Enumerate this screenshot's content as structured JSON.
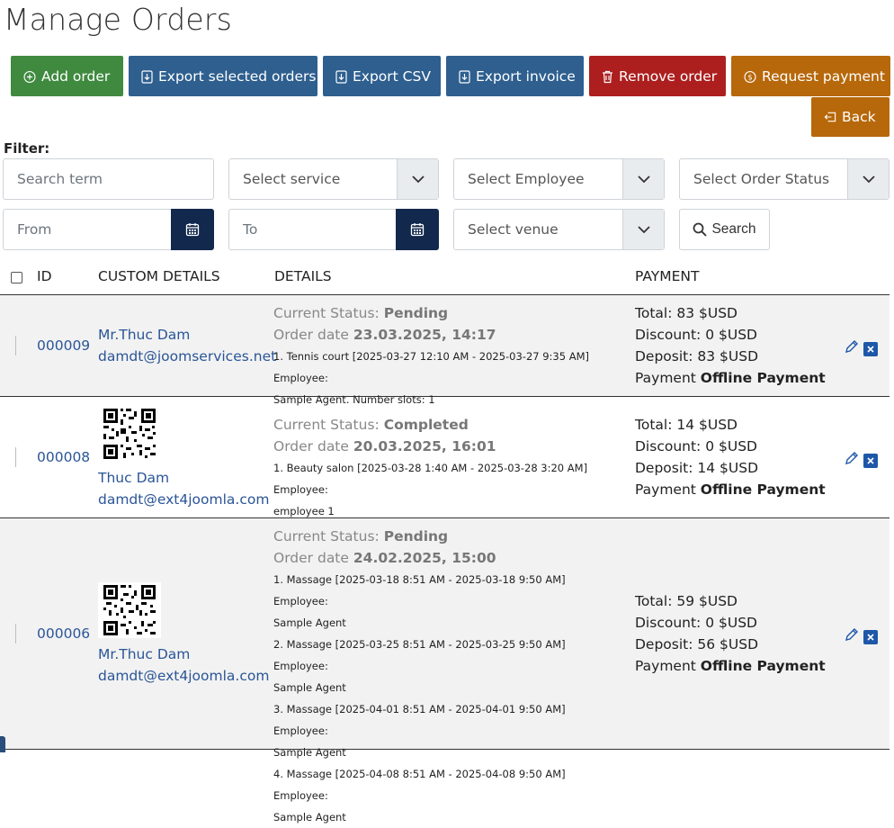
{
  "page": {
    "title": "Manage Orders"
  },
  "toolbar": {
    "add_order": "Add order",
    "export_selected": "Export selected orders",
    "export_csv": "Export CSV",
    "export_invoice": "Export invoice",
    "remove_order": "Remove order",
    "request_payment": "Request payment",
    "back": "Back"
  },
  "filter": {
    "label": "Filter:",
    "search_placeholder": "Search term",
    "service": "Select service",
    "employee": "Select Employee",
    "order_status": "Select Order Status",
    "from": "From",
    "to": "To",
    "venue": "Select venue",
    "search_button": "Search"
  },
  "table": {
    "columns": {
      "id": "ID",
      "custom": "CUSTOM DETAILS",
      "details": "DETAILS",
      "payment": "PAYMENT"
    },
    "rows": [
      {
        "id": "000009",
        "name": "Mr.Thuc Dam",
        "email": "damdt@joomservices.net",
        "status_label": "Current Status:",
        "status": "Pending",
        "date_label": "Order date",
        "date": "23.03.2025, 14:17",
        "items": [
          "1. Tennis court [2025-03-27 12:10 AM - 2025-03-27 9:35 AM] Employee:",
          "Sample Agent. Number slots: 1"
        ],
        "total": "Total: 83 $USD",
        "discount": "Discount: 0 $USD",
        "deposit": "Deposit: 83 $USD",
        "payment_label": "Payment",
        "payment_method": "Offline Payment"
      },
      {
        "id": "000008",
        "name": "Thuc Dam",
        "email": "damdt@ext4joomla.com",
        "status_label": "Current Status:",
        "status": "Completed",
        "date_label": "Order date",
        "date": "20.03.2025, 16:01",
        "items": [
          "1. Beauty salon [2025-03-28 1:40 AM - 2025-03-28 3:20 AM] Employee:",
          "employee 1"
        ],
        "total": "Total: 14 $USD",
        "discount": "Discount: 0 $USD",
        "deposit": "Deposit: 14 $USD",
        "payment_label": "Payment",
        "payment_method": "Offline Payment"
      },
      {
        "id": "000006",
        "name": "Mr.Thuc Dam",
        "email": "damdt@ext4joomla.com",
        "status_label": "Current Status:",
        "status": "Pending",
        "date_label": "Order date",
        "date": "24.02.2025, 15:00",
        "items": [
          "1. Massage [2025-03-18 8:51 AM - 2025-03-18 9:50 AM] Employee:",
          "Sample Agent",
          "2. Massage [2025-03-25 8:51 AM - 2025-03-25 9:50 AM] Employee:",
          "Sample Agent",
          "3. Massage [2025-04-01 8:51 AM - 2025-04-01 9:50 AM] Employee:",
          "Sample Agent",
          "4. Massage [2025-04-08 8:51 AM - 2025-04-08 9:50 AM] Employee:",
          "Sample Agent"
        ],
        "total": "Total: 59 $USD",
        "discount": "Discount: 0 $USD",
        "deposit": "Deposit: 56 $USD",
        "payment_label": "Payment",
        "payment_method": "Offline Payment"
      }
    ]
  },
  "icons": {
    "add": "plus-circle-icon",
    "export": "download-icon",
    "remove": "trash-icon",
    "request": "coin-icon",
    "back": "back-arrow-icon",
    "calendar": "calendar-icon",
    "caret": "chevron-down-icon",
    "search": "search-icon",
    "edit": "pencil-icon",
    "delete": "close-icon",
    "qr": "qr-code-icon"
  },
  "colors": {
    "green": "#3f8a3f",
    "blue": "#2e5f8f",
    "red": "#ad1f1f",
    "orange": "#b7680a",
    "navy": "#12284c",
    "link": "#2a5597"
  }
}
